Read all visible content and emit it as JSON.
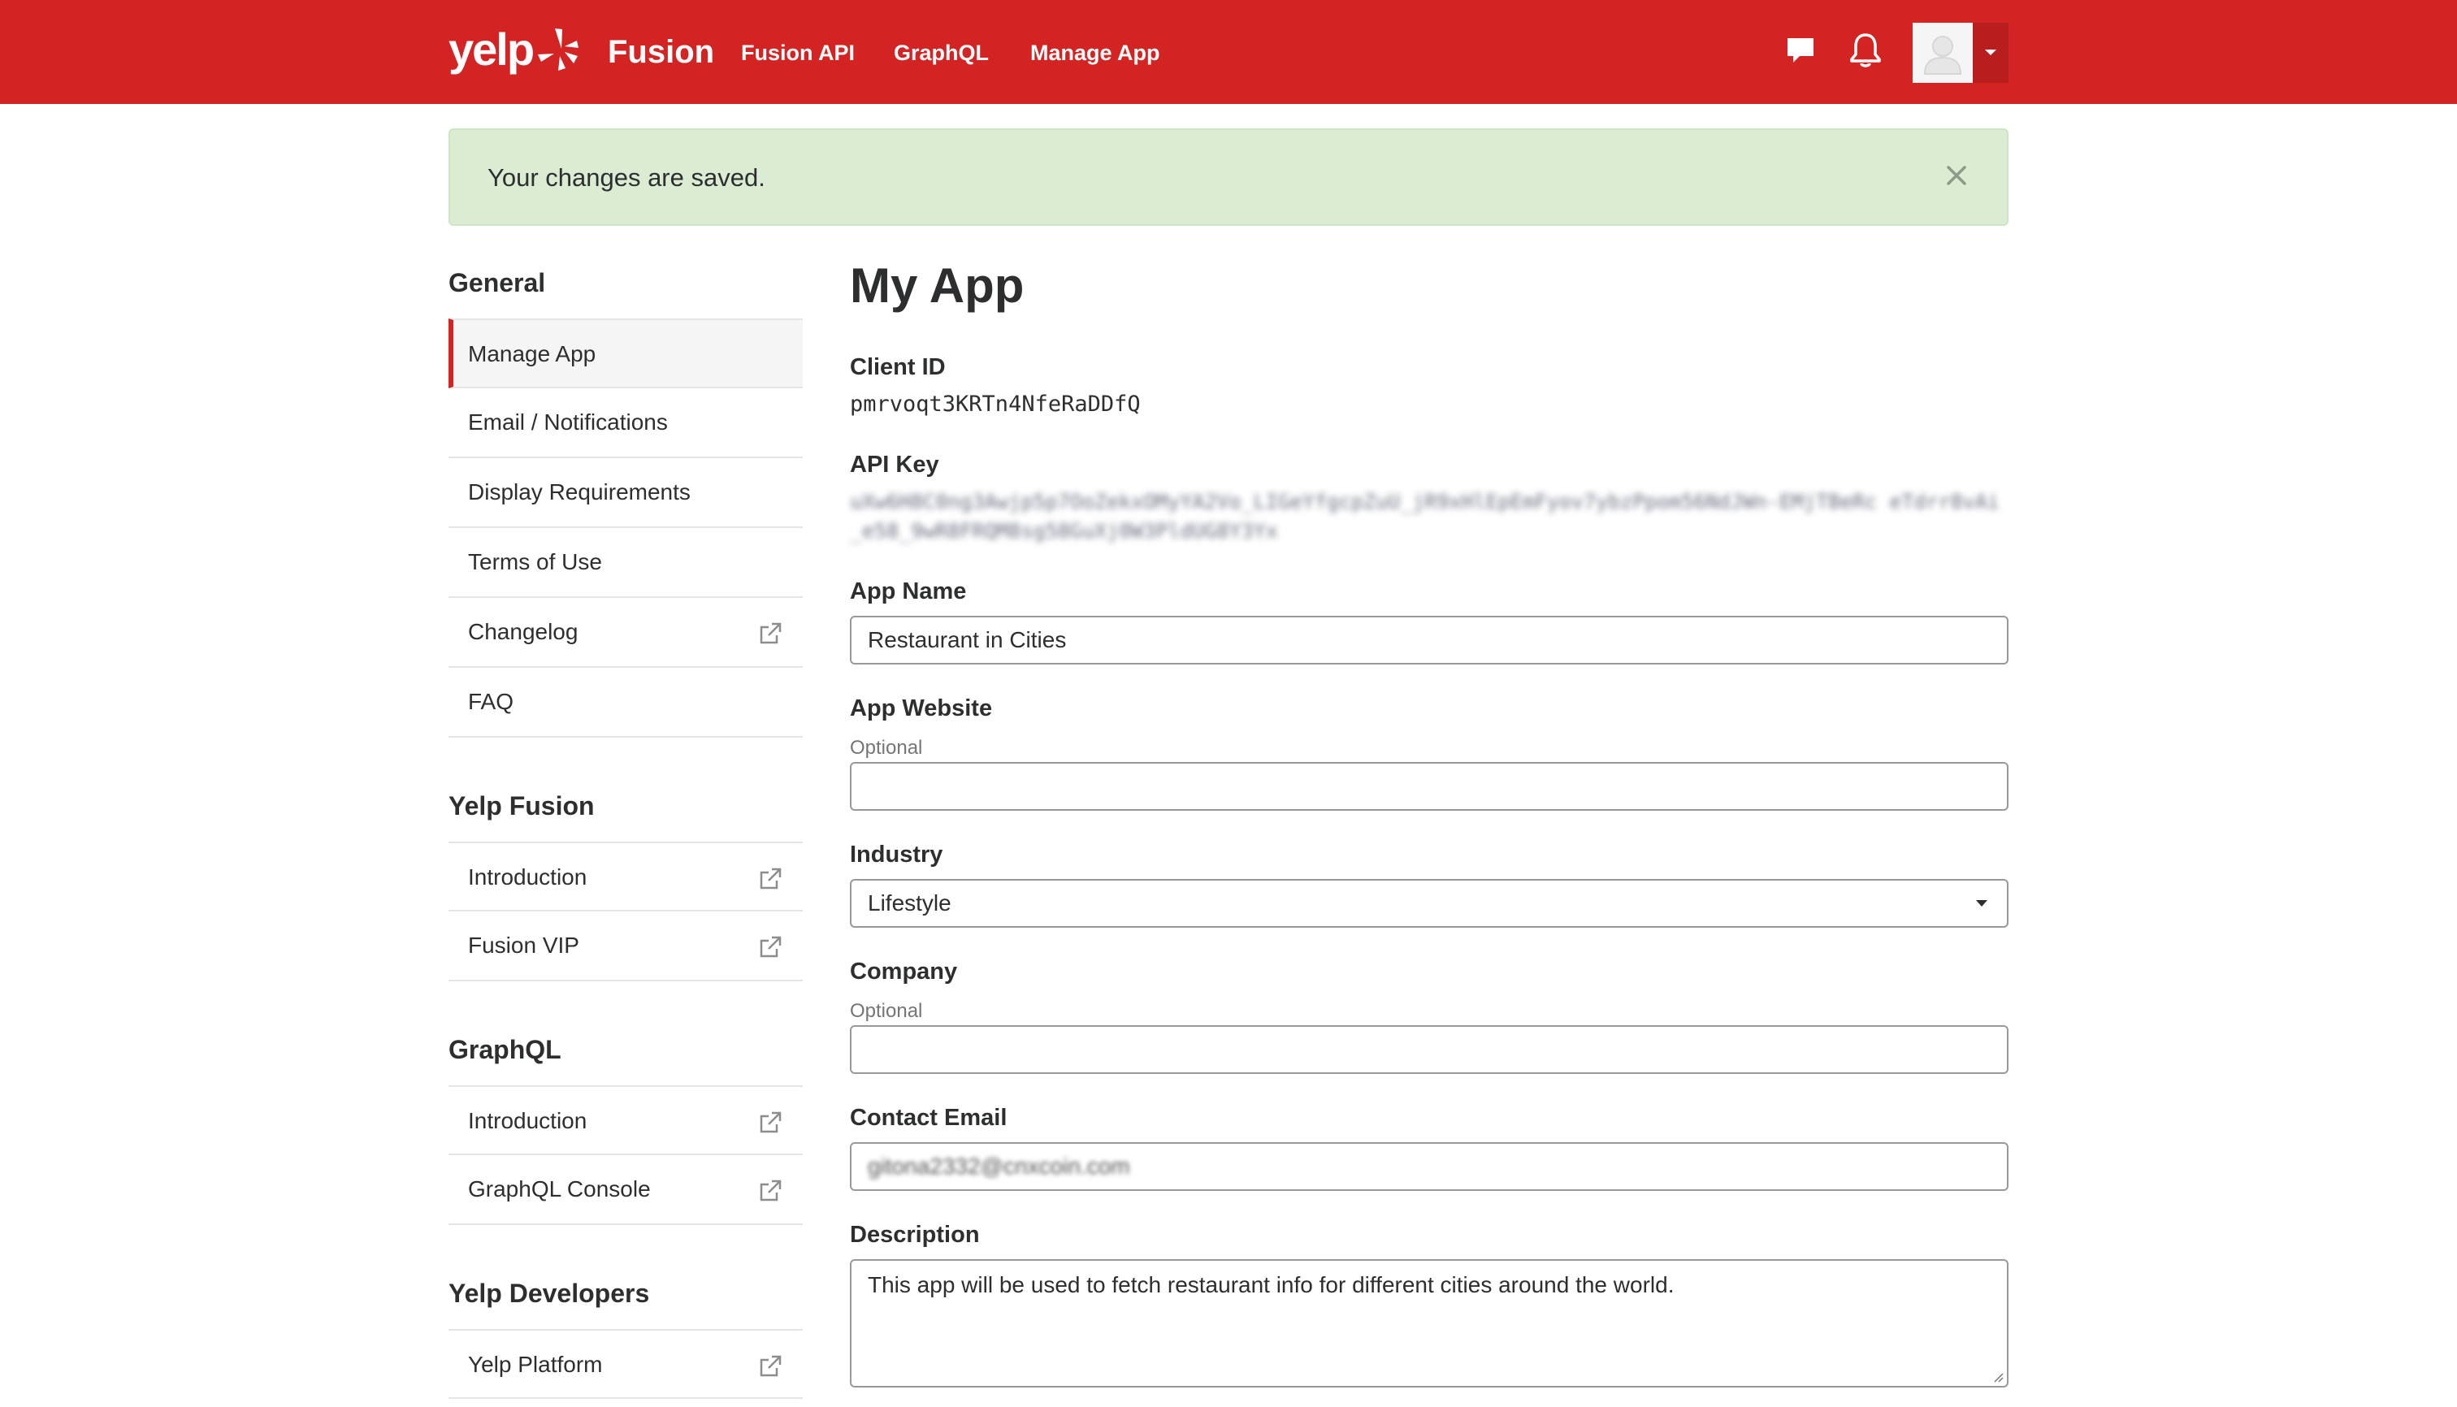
{
  "header": {
    "logo_text": "yelp",
    "product": "Fusion",
    "nav": [
      {
        "label": "Fusion API"
      },
      {
        "label": "GraphQL"
      },
      {
        "label": "Manage App"
      }
    ],
    "icons": {
      "messages": "chat-bubble-icon",
      "notifications": "bell-icon",
      "avatar": "user-avatar-icon",
      "menu": "caret-down-icon"
    },
    "colors": {
      "brand": "#d32323"
    }
  },
  "alert": {
    "message": "Your changes are saved.",
    "close_icon": "close-icon",
    "color": "#dbecd3"
  },
  "sidebar": {
    "sections": [
      {
        "heading": "General",
        "items": [
          {
            "label": "Manage App",
            "active": true,
            "external": false
          },
          {
            "label": "Email / Notifications",
            "external": false
          },
          {
            "label": "Display Requirements",
            "external": false
          },
          {
            "label": "Terms of Use",
            "external": false
          },
          {
            "label": "Changelog",
            "external": true
          },
          {
            "label": "FAQ",
            "external": false
          }
        ]
      },
      {
        "heading": "Yelp Fusion",
        "items": [
          {
            "label": "Introduction",
            "external": true
          },
          {
            "label": "Fusion VIP",
            "external": true
          }
        ]
      },
      {
        "heading": "GraphQL",
        "items": [
          {
            "label": "Introduction",
            "external": true
          },
          {
            "label": "GraphQL Console",
            "external": true
          }
        ]
      },
      {
        "heading": "Yelp Developers",
        "items": [
          {
            "label": "Yelp Platform",
            "external": true
          }
        ]
      }
    ]
  },
  "main": {
    "title": "My App",
    "client_id": {
      "label": "Client ID",
      "value": "pmrvoqt3KRTn4NfeRaDDfQ"
    },
    "api_key": {
      "label": "API Key",
      "value": "uXw6H8C0ng3Awjp5p7OoZekxOMyYA2Vo_LIGeYfgcpZuU_jR9xHlEpEmFyov7ybzPpom56NdJWn-EMjTBeRc eTdrr8vAi_e58_9wR8FRQM8sg58GuXj0W3PldUG8Y3Yx"
    },
    "app_name": {
      "label": "App Name",
      "value": "Restaurant in Cities"
    },
    "app_website": {
      "label": "App Website",
      "hint": "Optional",
      "value": ""
    },
    "industry": {
      "label": "Industry",
      "value": "Lifestyle"
    },
    "company": {
      "label": "Company",
      "hint": "Optional",
      "value": ""
    },
    "contact_email": {
      "label": "Contact Email",
      "value": "gitona2332@cnxcoin.com"
    },
    "description": {
      "label": "Description",
      "value": "This app will be used to fetch restaurant info for different cities around the world."
    }
  }
}
